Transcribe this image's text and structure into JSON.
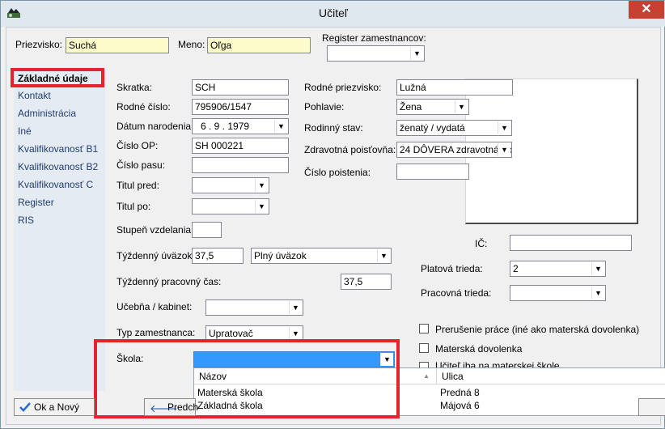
{
  "window": {
    "title": "Učiteľ",
    "close_glyph": "✕"
  },
  "header": {
    "priezvisko_label": "Priezvisko:",
    "priezvisko_value": "Suchá",
    "meno_label": "Meno:",
    "meno_value": "Oľga",
    "register_label": "Register zamestnancov:"
  },
  "sidebar": {
    "items": [
      {
        "label": "Základné údaje"
      },
      {
        "label": "Kontakt"
      },
      {
        "label": "Administrácia"
      },
      {
        "label": "Iné"
      },
      {
        "label": "Kvalifikovanosť B1"
      },
      {
        "label": "Kvalifikovanosť B2"
      },
      {
        "label": "Kvalifikovanosť C"
      },
      {
        "label": "Register"
      },
      {
        "label": "RIS"
      }
    ],
    "selected": "Základné údaje"
  },
  "form": {
    "skratka_label": "Skratka:",
    "skratka_value": "SCH",
    "rodne_cislo_label": "Rodné číslo:",
    "rodne_cislo_value": "795906/1547",
    "datum_label": "Dátum narodenia:",
    "datum_value": "6 . 9 . 1979",
    "cislo_op_label": "Číslo OP:",
    "cislo_op_value": "SH 000221",
    "cislo_pasu_label": "Číslo pasu:",
    "cislo_pasu_value": "",
    "titul_pred_label": "Titul pred:",
    "titul_pred_value": "",
    "titul_po_label": "Titul po:",
    "titul_po_value": "",
    "stupen_label": "Stupeň vzdelania:",
    "stupen_value": "",
    "tyzdenny_uvazok_label": "Týždenný úväzok:",
    "tyzdenny_uvazok_value": "37,5",
    "uvazok_type": "Plný úväzok",
    "tyzdenny_cas_label": "Týždenný pracovný čas:",
    "tyzdenny_cas_value": "37,5",
    "ucebna_label": "Učebňa / kabinet:",
    "ucebna_value": "",
    "typ_label": "Typ zamestnanca:",
    "typ_value": "Upratovač",
    "skola_label": "Škola:",
    "skola_value": "",
    "rodne_priezvisko_label": "Rodné priezvisko:",
    "rodne_priezvisko_value": "Lužná",
    "pohlavie_label": "Pohlavie:",
    "pohlavie_value": "Žena",
    "rodinny_stav_label": "Rodinný stav:",
    "rodinny_stav_value": "ženatý / vydatá",
    "poistovna_label": "Zdravotná poisťovňa:",
    "poistovna_value": "24 DÔVERA zdravotná po",
    "cislo_poistenia_label": "Číslo poistenia:",
    "cislo_poistenia_value": "",
    "ic_label": "IČ:",
    "ic_value": "",
    "platova_trieda_label": "Platová trieda:",
    "platova_trieda_value": "2",
    "pracovna_trieda_label": "Pracovná trieda:",
    "pracovna_trieda_value": "",
    "chk_prerusenie": "Prerušenie práce (iné ako materská dovolenka)",
    "chk_materska": "Materská dovolenka",
    "chk_ucitel": "Učiteľ iba na materskej škole"
  },
  "dropdown": {
    "columns": [
      "Názov",
      "Ulica"
    ],
    "rows": [
      {
        "nazov": "Materská škola",
        "ulica": "Predná 8"
      },
      {
        "nazov": "Základná škola",
        "ulica": "Májová 6"
      }
    ]
  },
  "buttons": {
    "ok_novy": "Ok a Nový",
    "predch": "Predch"
  },
  "colors": {
    "highlight": "#e5232d",
    "selection": "#3399ff",
    "sidebar_bg": "#e4ebf3",
    "yellow_input": "#fdfbc9"
  }
}
